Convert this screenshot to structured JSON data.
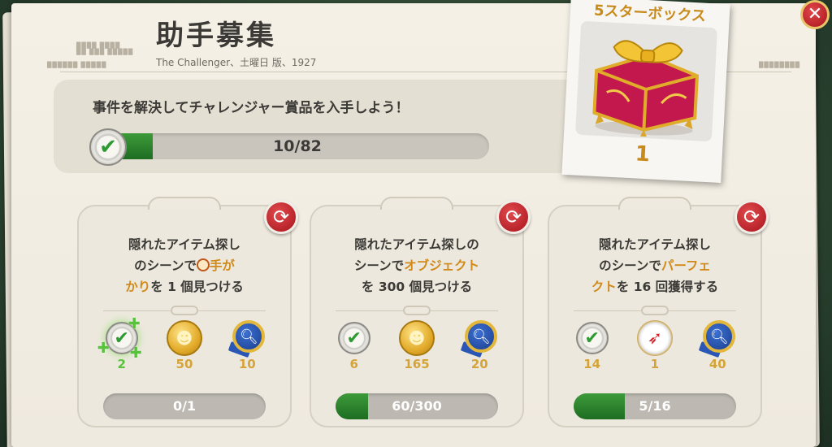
{
  "header": {
    "title": "助手募集",
    "subtitle": "The Challenger、土曜日 版、1927"
  },
  "banner": {
    "message": "事件を解決してチャレンジャー賞品を入手しよう！",
    "progress_text": "10/82",
    "progress_fraction": 0.122
  },
  "reward_box": {
    "title": "5スターボックス",
    "count": "1"
  },
  "tasks": [
    {
      "text_parts": [
        "隠れたアイテム探し",
        "のシーンで",
        "手が",
        "かり",
        "を 1 個見つける"
      ],
      "rewards": [
        {
          "icon": "check-medal-icon",
          "value": "2",
          "color": "#58c23d"
        },
        {
          "icon": "gold-coin-icon",
          "value": "50"
        },
        {
          "icon": "magnifier-badge-icon",
          "value": "10"
        }
      ],
      "progress_text": "0/1",
      "progress_fraction": 0.0
    },
    {
      "text_parts": [
        "隠れたアイテム探しの",
        "シーンで",
        "オブジェクト",
        "を 300 個見つける"
      ],
      "rewards": [
        {
          "icon": "check-medal-icon",
          "value": "6"
        },
        {
          "icon": "gold-coin-icon",
          "value": "165"
        },
        {
          "icon": "magnifier-badge-icon",
          "value": "20"
        }
      ],
      "progress_text": "60/300",
      "progress_fraction": 0.2
    },
    {
      "text_parts": [
        "隠れたアイテム探し",
        "のシーンで",
        "パーフェ",
        "クト",
        "を 16 回獲得する"
      ],
      "rewards": [
        {
          "icon": "check-medal-icon",
          "value": "14"
        },
        {
          "icon": "compass-icon",
          "value": "1"
        },
        {
          "icon": "magnifier-badge-icon",
          "value": "40"
        }
      ],
      "progress_text": "5/16",
      "progress_fraction": 0.3125
    }
  ],
  "colors": {
    "highlight": "#d18a1a",
    "progress_green": "#2a8a2e",
    "reward_value": "#d4a43a",
    "close_red": "#c8242a"
  }
}
